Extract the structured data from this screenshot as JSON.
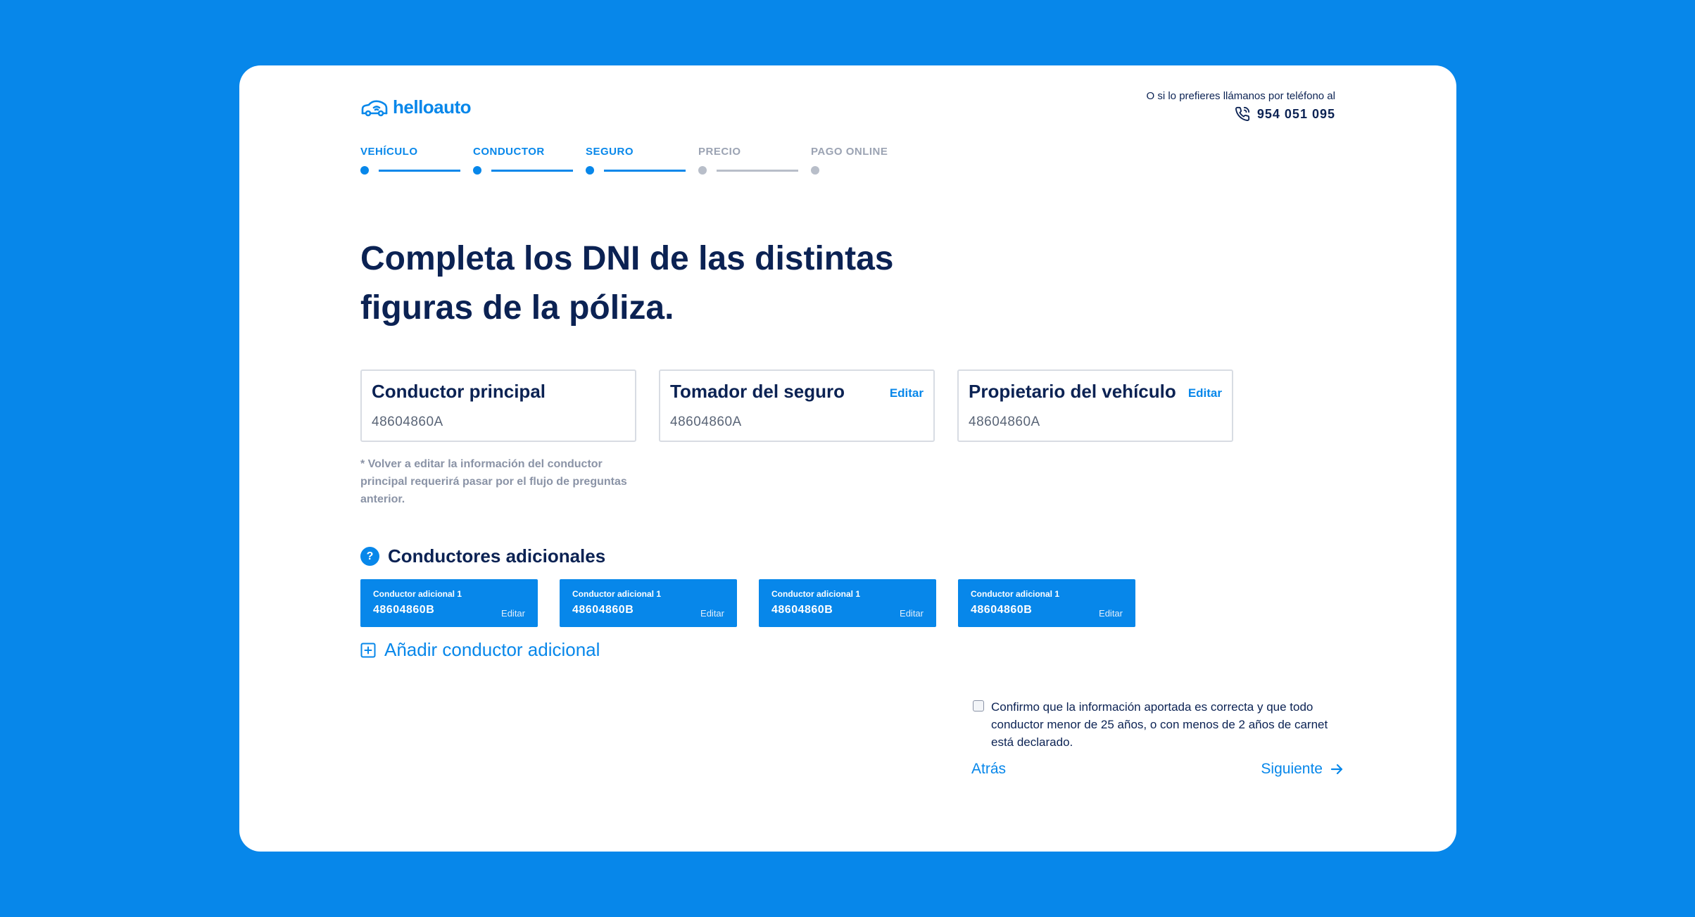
{
  "brand": {
    "name": "helloauto",
    "icon": "car-wifi-logo",
    "accent": "#0787EA",
    "background": "#0787EA",
    "text_dark": "#0B2253"
  },
  "contact": {
    "caption": "O si lo prefieres llámanos por teléfono al",
    "phone": "954 051 095",
    "icon": "phone-icon"
  },
  "stepper": {
    "steps": [
      {
        "label": "VEHÍCULO",
        "state": "active"
      },
      {
        "label": "CONDUCTOR",
        "state": "active"
      },
      {
        "label": "SEGURO",
        "state": "active"
      },
      {
        "label": "PRECIO",
        "state": "inactive"
      },
      {
        "label": "PAGO ONLINE",
        "state": "inactive"
      }
    ]
  },
  "title": "Completa los DNI de las distintas figuras de la póliza.",
  "dni_boxes": [
    {
      "title": "Conductor principal",
      "value": "48604860A",
      "edit": ""
    },
    {
      "title": "Tomador del seguro",
      "value": "48604860A",
      "edit": "Editar"
    },
    {
      "title": "Propietario del vehículo",
      "value": "48604860A",
      "edit": "Editar"
    }
  ],
  "note": "* Volver a editar la información del conductor principal requerirá pasar por el flujo de preguntas anterior.",
  "additional": {
    "help_icon": "?",
    "title": "Conductores adicionales",
    "drivers": [
      {
        "label": "Conductor adicional 1",
        "value": "48604860B",
        "edit": "Editar"
      },
      {
        "label": "Conductor adicional 1",
        "value": "48604860B",
        "edit": "Editar"
      },
      {
        "label": "Conductor adicional 1",
        "value": "48604860B",
        "edit": "Editar"
      },
      {
        "label": "Conductor adicional 1",
        "value": "48604860B",
        "edit": "Editar"
      }
    ],
    "add_label": "Añadir conductor adicional",
    "add_icon": "plus-square-icon"
  },
  "confirm": {
    "checked": false,
    "text": "Confirmo que la información aportada es correcta y que todo conductor menor de 25 años, o con menos de 2 años de carnet está declarado."
  },
  "nav": {
    "back": "Atrás",
    "next": "Siguiente",
    "next_icon": "arrow-right-icon"
  }
}
